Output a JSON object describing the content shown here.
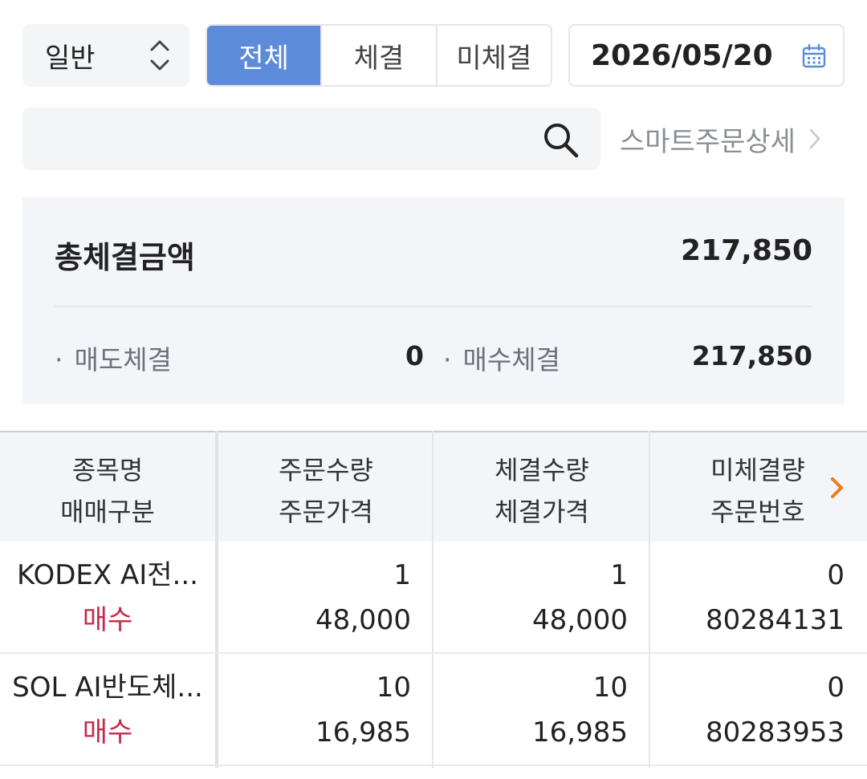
{
  "filters": {
    "order_type": "일반",
    "segments": [
      "전체",
      "체결",
      "미체결"
    ],
    "active_segment": 0,
    "date": "2026/05/20"
  },
  "search": {
    "placeholder": "",
    "smart_order_link": "스마트주문상세"
  },
  "summary": {
    "total_label": "총체결금액",
    "total_value": "217,850",
    "sell_label": "매도체결",
    "sell_value": "0",
    "buy_label": "매수체결",
    "buy_value": "217,850"
  },
  "table": {
    "headers": [
      [
        "종목명",
        "매매구분"
      ],
      [
        "주문수량",
        "주문가격"
      ],
      [
        "체결수량",
        "체결가격"
      ],
      [
        "미체결량",
        "주문번호"
      ]
    ],
    "rows": [
      {
        "name": "KODEX AI전...",
        "side": "매수",
        "order_qty": "1",
        "order_price": "48,000",
        "filled_qty": "1",
        "filled_price": "48,000",
        "unfilled_qty": "0",
        "order_no": "80284131"
      },
      {
        "name": "SOL AI반도체...",
        "side": "매수",
        "order_qty": "10",
        "order_price": "16,985",
        "filled_qty": "10",
        "filled_price": "16,985",
        "unfilled_qty": "0",
        "order_no": "80283953"
      }
    ]
  },
  "colors": {
    "accent": "#5b8bd9",
    "buy": "#c8284a",
    "header_arrow": "#f07a1a"
  }
}
